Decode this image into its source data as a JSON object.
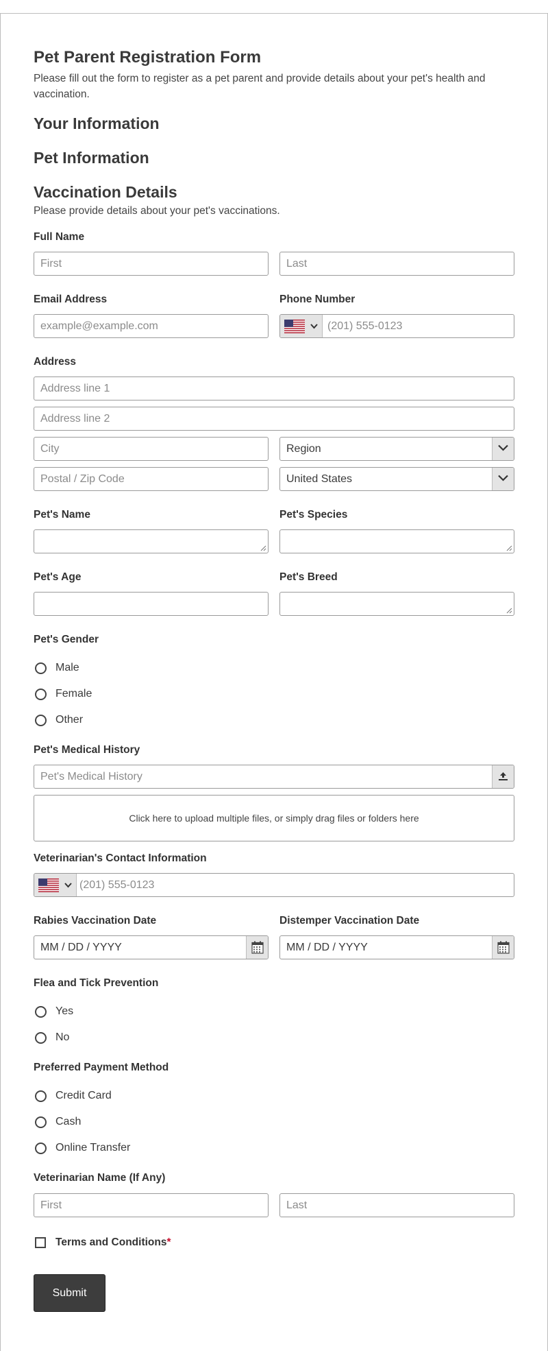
{
  "form": {
    "title": "Pet Parent Registration Form",
    "description": "Please fill out the form to register as a pet parent and provide details about your pet's health and vaccination.",
    "sections": {
      "your_info": "Your Information",
      "pet_info": "Pet Information",
      "vaccination": "Vaccination Details",
      "vaccination_desc": "Please provide details about your pet's vaccinations."
    }
  },
  "full_name": {
    "label": "Full Name",
    "first_placeholder": "First",
    "last_placeholder": "Last"
  },
  "email": {
    "label": "Email Address",
    "placeholder": "example@example.com"
  },
  "phone": {
    "label": "Phone Number",
    "placeholder": "(201) 555-0123"
  },
  "address": {
    "label": "Address",
    "line1": "Address line 1",
    "line2": "Address line 2",
    "city": "City",
    "region": "Region",
    "postal": "Postal / Zip Code",
    "country": "United States"
  },
  "pet_name": {
    "label": "Pet's Name"
  },
  "pet_species": {
    "label": "Pet's Species"
  },
  "pet_age": {
    "label": "Pet's Age"
  },
  "pet_breed": {
    "label": "Pet's Breed"
  },
  "pet_gender": {
    "label": "Pet's Gender",
    "options": [
      "Male",
      "Female",
      "Other"
    ]
  },
  "medical_history": {
    "label": "Pet's Medical History",
    "placeholder": "Pet's Medical History",
    "upload_text": "Click here to upload multiple files, or simply drag files or folders here"
  },
  "vet_contact": {
    "label": "Veterinarian's Contact Information",
    "placeholder": "(201) 555-0123"
  },
  "rabies": {
    "label": "Rabies Vaccination Date",
    "placeholder": "MM / DD / YYYY"
  },
  "distemper": {
    "label": "Distemper Vaccination Date",
    "placeholder": "MM / DD / YYYY"
  },
  "flea": {
    "label": "Flea and Tick Prevention",
    "options": [
      "Yes",
      "No"
    ]
  },
  "payment": {
    "label": "Preferred Payment Method",
    "options": [
      "Credit Card",
      "Cash",
      "Online Transfer"
    ]
  },
  "vet_name": {
    "label": "Veterinarian Name (If Any)",
    "first_placeholder": "First",
    "last_placeholder": "Last"
  },
  "terms": {
    "label": "Terms and Conditions",
    "required_mark": "*"
  },
  "submit": {
    "label": "Submit"
  },
  "icons": {
    "flag": "us-flag-icon",
    "chevron": "chevron-down-icon",
    "calendar": "calendar-icon",
    "upload": "upload-icon"
  },
  "colors": {
    "text": "#3a3a3a",
    "border": "#9a9a9a",
    "submit_bg": "#3d3d3d",
    "required": "#c8102e"
  }
}
